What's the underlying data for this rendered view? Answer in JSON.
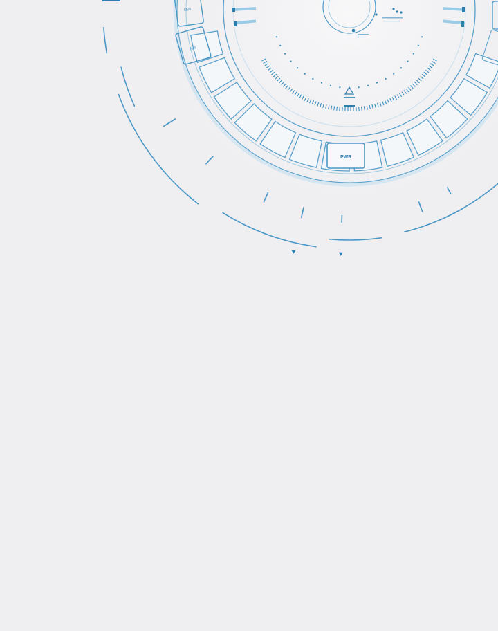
{
  "page": {
    "background": "#efeff2"
  },
  "hud": {
    "accent_color": "#2d7fae",
    "accent_light": "#8cc1de",
    "accent_pale": "#cfe4f1",
    "center_readout": "",
    "buttons": [
      {
        "label": "PWR",
        "icon": "power-icon"
      },
      {
        "label": "",
        "icon": "panel-icon"
      },
      {
        "label": "",
        "icon": "panel-icon"
      },
      {
        "label": "",
        "icon": "panel-icon"
      }
    ],
    "left_tiles": [
      {
        "label": ""
      },
      {
        "label": ""
      }
    ],
    "warning_icon": "triangle-alert-icon"
  }
}
